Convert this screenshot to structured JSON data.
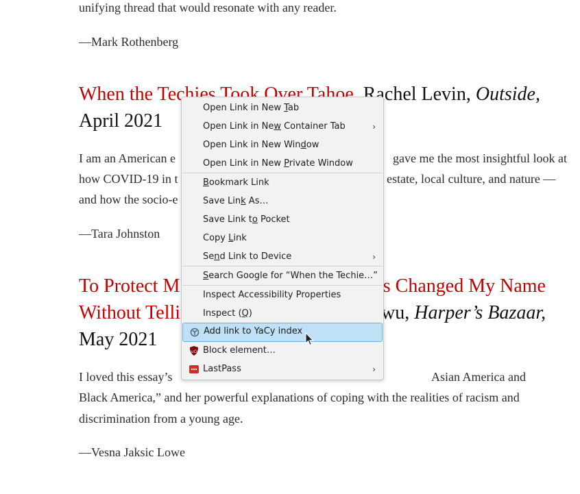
{
  "article": {
    "intro_tail": "unifying thread that would resonate with any reader.",
    "attrib1": "—Mark Rothenberg",
    "entry2": {
      "title_link": "When the Techies Took Over Tahoe",
      "title_sep": ",",
      "author": " Rachel Levin, ",
      "publication": "Outside,",
      "date": "April 2021"
    },
    "para2": [
      "I am an American e",
      "gave me the most insightful look at",
      "how COVID-19 in t",
      "estate, local culture, and nature —",
      "and how the socio-e"
    ],
    "attrib2": "—Tara Johnston",
    "entry3": {
      "title_link_a1": "To Protect M",
      "title_link_a2": "nts Changed My Name",
      "title_link_b": "Without Telli",
      "author_tail": "wu, ",
      "publication": "Harper’s Bazaar,",
      "date": "May 2021"
    },
    "para3": [
      "I loved this essay’s ",
      "Asian America and",
      "Black America,” and her powerful explanations of coping with the realities of racism and",
      "discrimination from a young age."
    ],
    "attrib3": "—Vesna Jaksic Lowe"
  },
  "menu": {
    "items": [
      {
        "label_pre": "Open Link in New ",
        "ul": "T",
        "label_post": "ab",
        "submenu": false
      },
      {
        "label_pre": "Open Link in Ne",
        "ul": "w",
        "label_post": " Container Tab",
        "submenu": true
      },
      {
        "label_pre": "Open Link in New Win",
        "ul": "d",
        "label_post": "ow",
        "submenu": false
      },
      {
        "label_pre": "Open Link in New ",
        "ul": "P",
        "label_post": "rivate Window",
        "submenu": false
      },
      {
        "label_pre": "",
        "ul": "B",
        "label_post": "ookmark Link",
        "submenu": false
      },
      {
        "label_pre": "Save Lin",
        "ul": "k",
        "label_post": " As…",
        "submenu": false
      },
      {
        "label_pre": "Save Link t",
        "ul": "o",
        "label_post": " Pocket",
        "submenu": false
      },
      {
        "label_pre": "Copy ",
        "ul": "L",
        "label_post": "ink",
        "submenu": false
      },
      {
        "label_pre": "Se",
        "ul": "n",
        "label_post": "d Link to Device",
        "submenu": true
      },
      {
        "label_pre": "",
        "ul": "S",
        "label_post": "earch Google for “When the Techie…”",
        "submenu": false
      },
      {
        "label_pre": "Inspect Accessibility Properties",
        "ul": "",
        "label_post": "",
        "submenu": false
      },
      {
        "label_pre": "Inspect (",
        "ul": "Q",
        "label_post": ")",
        "submenu": false
      },
      {
        "label_pre": "Add link to YaCy index",
        "ul": "",
        "label_post": "",
        "submenu": false,
        "icon": "yacy-icon"
      },
      {
        "label_pre": "Block element…",
        "ul": "",
        "label_post": "",
        "submenu": false,
        "icon": "ublock-origin-icon"
      },
      {
        "label_pre": "LastPass",
        "ul": "",
        "label_post": "",
        "submenu": true,
        "icon": "lastpass-icon"
      }
    ],
    "arrow": "›"
  },
  "colors": {
    "link_red": "#c20000",
    "highlight": "#bfe0f5",
    "menu_bg": "#f2f2f3"
  }
}
